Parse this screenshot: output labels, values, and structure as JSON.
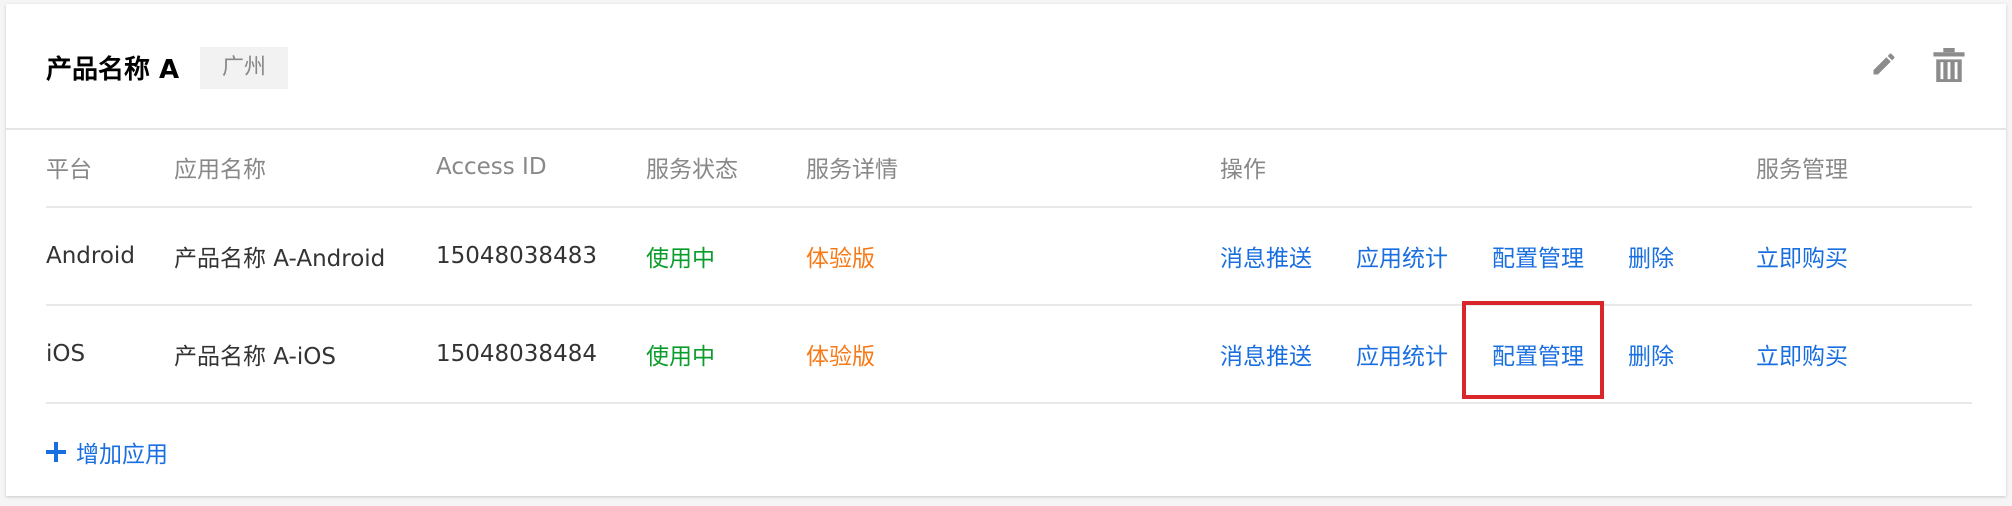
{
  "product": {
    "title": "产品名称 A",
    "region": "广州"
  },
  "header_icons": [
    "edit-icon",
    "trash-icon"
  ],
  "table": {
    "columns": [
      "平台",
      "应用名称",
      "Access ID",
      "服务状态",
      "服务详情",
      "操作",
      "服务管理"
    ],
    "rows": [
      {
        "platform": "Android",
        "app_name": "产品名称 A-Android",
        "access_id": "15048038483",
        "status": "使用中",
        "detail": "体验版",
        "ops": [
          "消息推送",
          "应用统计",
          "配置管理",
          "删除"
        ],
        "manage": "立即购买"
      },
      {
        "platform": "iOS",
        "app_name": "产品名称 A-iOS",
        "access_id": "15048038484",
        "status": "使用中",
        "detail": "体验版",
        "ops": [
          "消息推送",
          "应用统计",
          "配置管理",
          "删除"
        ],
        "manage": "立即购买"
      }
    ]
  },
  "add_app_label": "增加应用",
  "colors": {
    "link": "#1a6fe0",
    "status_active": "#0b9d2b",
    "detail_trial": "#f77a19",
    "highlight": "#d9262a"
  }
}
